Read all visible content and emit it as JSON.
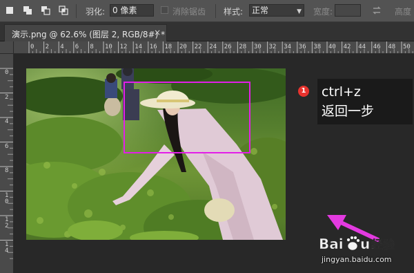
{
  "options_bar": {
    "feather_label": "羽化:",
    "feather_value": "0 像素",
    "antialias_label": "消除锯齿",
    "style_label": "样式:",
    "style_value": "正常",
    "width_label": "宽度:",
    "height_label": "高度"
  },
  "document_tab": {
    "title": "演示.png @ 62.6% (图层 2, RGB/8#) *",
    "close_glyph": "×"
  },
  "rulers": {
    "horizontal_ticks": [
      "0",
      "2",
      "4",
      "6",
      "8",
      "10",
      "12",
      "14",
      "16",
      "18",
      "20",
      "22",
      "24",
      "26",
      "28",
      "30",
      "32",
      "34",
      "36",
      "38",
      "40",
      "42",
      "44",
      "46",
      "48",
      "50"
    ],
    "vertical_ticks": [
      "0",
      "2",
      "4",
      "6",
      "8",
      "10",
      "12",
      "14"
    ]
  },
  "annotation": {
    "step_number": "1",
    "line1": "ctrl+z",
    "line2": "返回一步",
    "selection_color": "#e31ee8",
    "arrow_color": "#e33ae0"
  },
  "watermark": {
    "url": "jingyan.baidu.com"
  }
}
